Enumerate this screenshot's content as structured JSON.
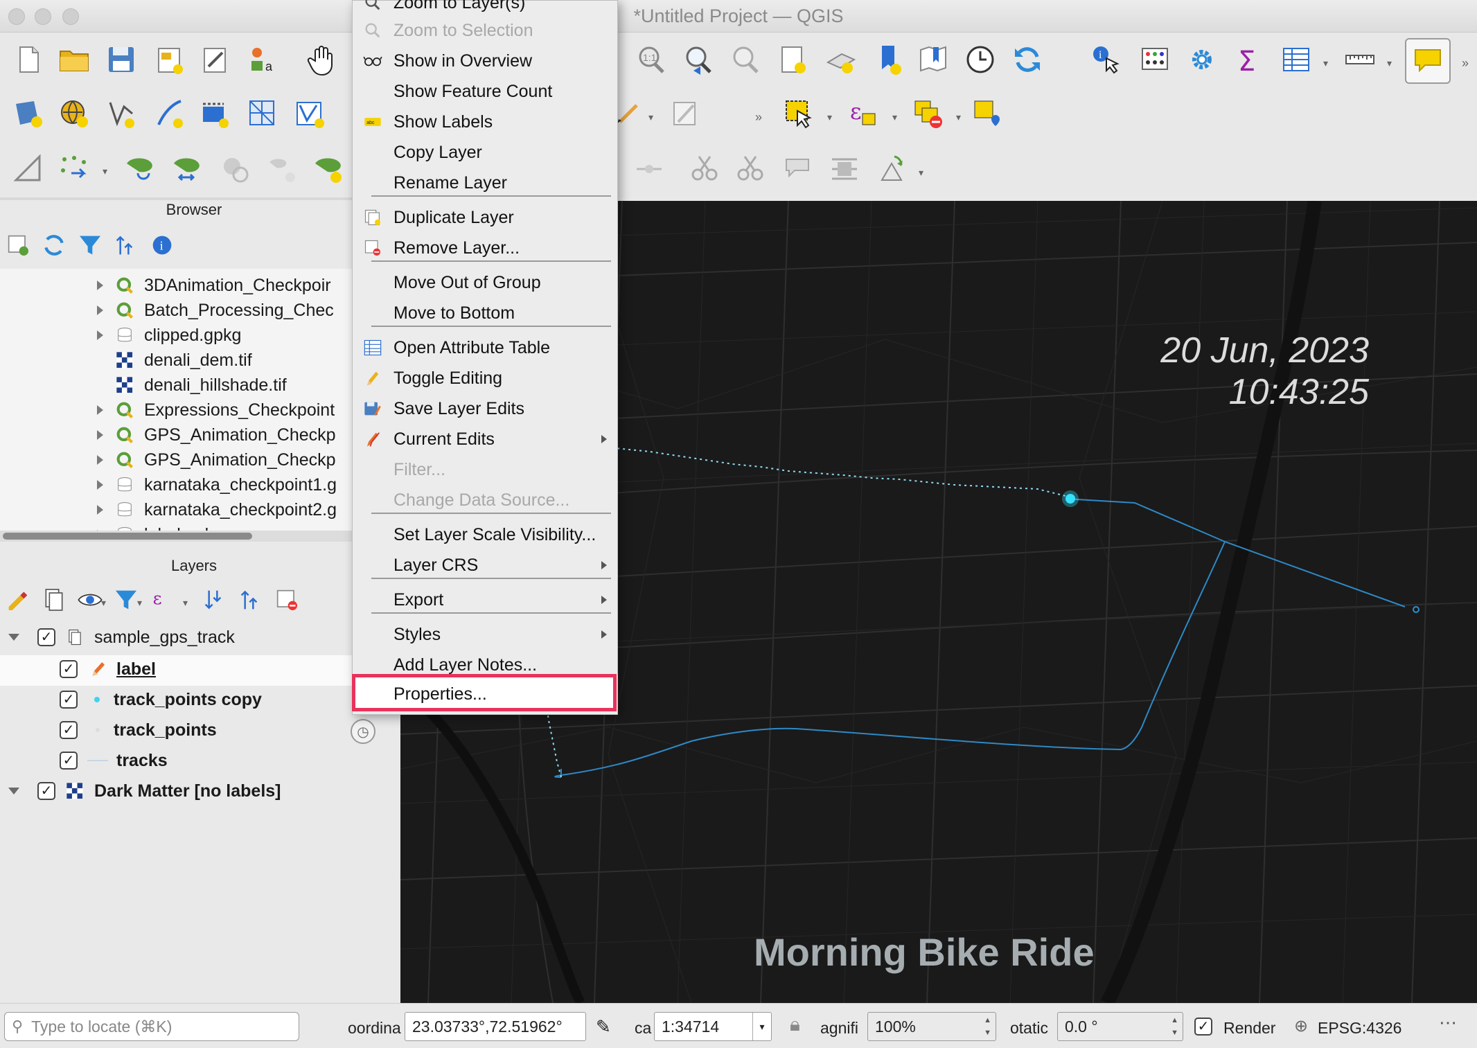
{
  "window": {
    "title": "*Untitled Project — QGIS"
  },
  "browser": {
    "title": "Browser",
    "items": [
      {
        "label": "3DAnimation_Checkpoir",
        "icon": "qgis-project-icon",
        "expandable": true
      },
      {
        "label": "Batch_Processing_Chec",
        "icon": "qgis-project-icon",
        "expandable": true
      },
      {
        "label": "clipped.gpkg",
        "icon": "geopackage-icon",
        "expandable": true
      },
      {
        "label": "denali_dem.tif",
        "icon": "raster-icon",
        "expandable": false
      },
      {
        "label": "denali_hillshade.tif",
        "icon": "raster-icon",
        "expandable": false
      },
      {
        "label": "Expressions_Checkpoint",
        "icon": "qgis-project-icon",
        "expandable": true
      },
      {
        "label": "GPS_Animation_Checkp",
        "icon": "qgis-project-icon",
        "expandable": true
      },
      {
        "label": "GPS_Animation_Checkp",
        "icon": "qgis-project-icon",
        "expandable": true
      },
      {
        "label": "karnataka_checkpoint1.g",
        "icon": "geopackage-icon",
        "expandable": true
      },
      {
        "label": "karnataka_checkpoint2.g",
        "icon": "geopackage-icon",
        "expandable": true
      },
      {
        "label": "label.gpkg",
        "icon": "geopackage-icon",
        "expandable": true
      }
    ]
  },
  "layers": {
    "title": "Layers",
    "group": {
      "label": "sample_gps_track"
    },
    "items": [
      {
        "label": "label",
        "icon": "pencil-icon"
      },
      {
        "label": "track_points copy",
        "icon": "point-icon"
      },
      {
        "label": "track_points",
        "icon": "point-icon"
      },
      {
        "label": "tracks",
        "icon": "line-icon"
      }
    ],
    "basemap": {
      "label": "Dark Matter [no labels]",
      "icon": "tile-icon"
    }
  },
  "context_menu": {
    "items": [
      {
        "label": "Zoom to Layer(s)",
        "icon": "zoom-layer-icon",
        "enabled": true
      },
      {
        "label": "Zoom to Selection",
        "icon": "zoom-selection-icon",
        "enabled": false
      },
      {
        "label": "Show in Overview",
        "icon": "glasses-icon",
        "enabled": true
      },
      {
        "label": "Show Feature Count",
        "icon": "",
        "enabled": true
      },
      {
        "label": "Show Labels",
        "icon": "labels-icon",
        "enabled": true
      },
      {
        "label": "Copy Layer",
        "icon": "",
        "enabled": true
      },
      {
        "label": "Rename Layer",
        "icon": "",
        "enabled": true
      },
      {
        "label": "Duplicate Layer",
        "icon": "duplicate-icon",
        "enabled": true
      },
      {
        "label": "Remove Layer...",
        "icon": "remove-icon",
        "enabled": true
      },
      {
        "label": "Move Out of Group",
        "icon": "",
        "enabled": true
      },
      {
        "label": "Move to Bottom",
        "icon": "",
        "enabled": true
      },
      {
        "label": "Open Attribute Table",
        "icon": "table-icon",
        "enabled": true
      },
      {
        "label": "Toggle Editing",
        "icon": "pencil-icon",
        "enabled": true
      },
      {
        "label": "Save Layer Edits",
        "icon": "save-edits-icon",
        "enabled": true
      },
      {
        "label": "Current Edits",
        "icon": "current-edits-icon",
        "enabled": true,
        "submenu": true
      },
      {
        "label": "Filter...",
        "icon": "",
        "enabled": false
      },
      {
        "label": "Change Data Source...",
        "icon": "",
        "enabled": false
      },
      {
        "label": "Set Layer Scale Visibility...",
        "icon": "",
        "enabled": true
      },
      {
        "label": "Layer CRS",
        "icon": "",
        "enabled": true,
        "submenu": true
      },
      {
        "label": "Export",
        "icon": "",
        "enabled": true,
        "submenu": true
      },
      {
        "label": "Styles",
        "icon": "",
        "enabled": true,
        "submenu": true
      },
      {
        "label": "Add Layer Notes...",
        "icon": "",
        "enabled": true
      },
      {
        "label": "Properties...",
        "icon": "",
        "enabled": true,
        "highlighted": true
      }
    ]
  },
  "map": {
    "date": "20 Jun, 2023",
    "time": "10:43:25",
    "title": "Morning Bike Ride",
    "track_color": "#4aa3e0",
    "marker_color": "#36e3ff"
  },
  "statusbar": {
    "locator_placeholder": "Type to locate (⌘K)",
    "coordinate_label": "oordina",
    "coordinate": "23.03733°,72.51962°",
    "scale_label": "ca",
    "scale": "1:34714",
    "magnifier_label": "agnifi",
    "magnifier": "100%",
    "rotation_label": "otatic",
    "rotation": "0.0 °",
    "render_label": "Render",
    "crs": "EPSG:4326"
  },
  "colors": {
    "highlight_border": "#e8335c",
    "qgis_green": "#5b9e3a",
    "toolbar_bg": "#e8e8e8"
  }
}
